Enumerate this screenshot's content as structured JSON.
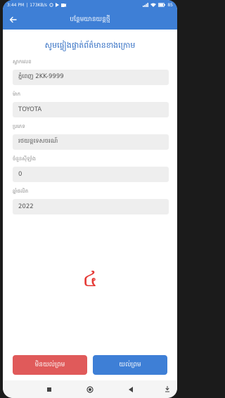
{
  "status_bar": {
    "time": "3:44 PM",
    "network_speed": "173KB/s",
    "battery": "85"
  },
  "app_bar": {
    "title": "បន្ថែមយានយន្តថ្មី",
    "back_icon": "arrow-left-icon"
  },
  "form": {
    "heading": "សូមផ្ទៀងផ្ទាត់ព័ត៌មានខាងក្រោម",
    "fields": [
      {
        "label": "ស្លាកលេខ",
        "value": "ភ្នំពេញ 2KK-9999"
      },
      {
        "label": "ម៉ាក",
        "value": "TOYOTA"
      },
      {
        "label": "ប្រភេទ",
        "value": "រថយន្តទេសចរណ៍"
      },
      {
        "label": "ចំនួនស៊ីឡាំង",
        "value": "0"
      },
      {
        "label": "ឆ្នាំផលិត",
        "value": "2022"
      }
    ]
  },
  "step_number": "៤",
  "buttons": {
    "cancel": "មិនយល់ព្រម",
    "confirm": "យល់ព្រម"
  },
  "colors": {
    "primary": "#3e7fd6",
    "danger": "#e05a5a",
    "step_number": "#e53935"
  }
}
